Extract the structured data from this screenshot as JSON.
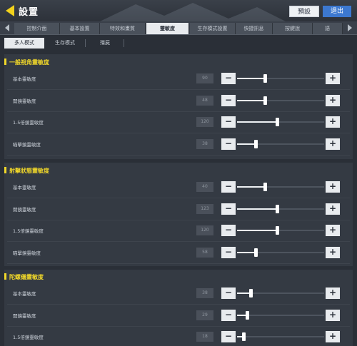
{
  "header": {
    "title": "設置",
    "reset_label": "預設",
    "close_label": "退出"
  },
  "tabs": [
    {
      "label": "控制介面",
      "active": false
    },
    {
      "label": "基本設置",
      "active": false
    },
    {
      "label": "特效和畫質",
      "active": false
    },
    {
      "label": "靈敏度",
      "active": true
    },
    {
      "label": "生存模式設置",
      "active": false
    },
    {
      "label": "快捷訊息",
      "active": false
    },
    {
      "label": "按鍵說",
      "active": false
    },
    {
      "label": "語",
      "active": false
    }
  ],
  "subtabs": [
    {
      "label": "多人模式",
      "active": true
    },
    {
      "label": "生存模式",
      "active": false
    },
    {
      "label": "殭屍",
      "active": false
    }
  ],
  "sections": [
    {
      "title": "一般視角靈敏度",
      "rows": [
        {
          "label": "基本靈敏度",
          "value": "90",
          "level": 0.33
        },
        {
          "label": "開鏡靈敏度",
          "value": "48",
          "level": 0.33
        },
        {
          "label": "1.5倍鏡靈敏度",
          "value": "120",
          "level": 0.47
        },
        {
          "label": "瞄擊鏡靈敏度",
          "value": "38",
          "level": 0.22
        }
      ]
    },
    {
      "title": "射擊狀態靈敏度",
      "rows": [
        {
          "label": "基本靈敏度",
          "value": "40",
          "level": 0.33
        },
        {
          "label": "開鏡靈敏度",
          "value": "123",
          "level": 0.47
        },
        {
          "label": "1.5倍鏡靈敏度",
          "value": "120",
          "level": 0.47
        },
        {
          "label": "瞄擊鏡靈敏度",
          "value": "58",
          "level": 0.22
        }
      ]
    },
    {
      "title": "陀螺儀靈敏度",
      "rows": [
        {
          "label": "基本靈敏度",
          "value": "38",
          "level": 0.16
        },
        {
          "label": "開鏡靈敏度",
          "value": "29",
          "level": 0.12
        },
        {
          "label": "1.5倍鏡靈敏度",
          "value": "18",
          "level": 0.08
        }
      ]
    }
  ]
}
